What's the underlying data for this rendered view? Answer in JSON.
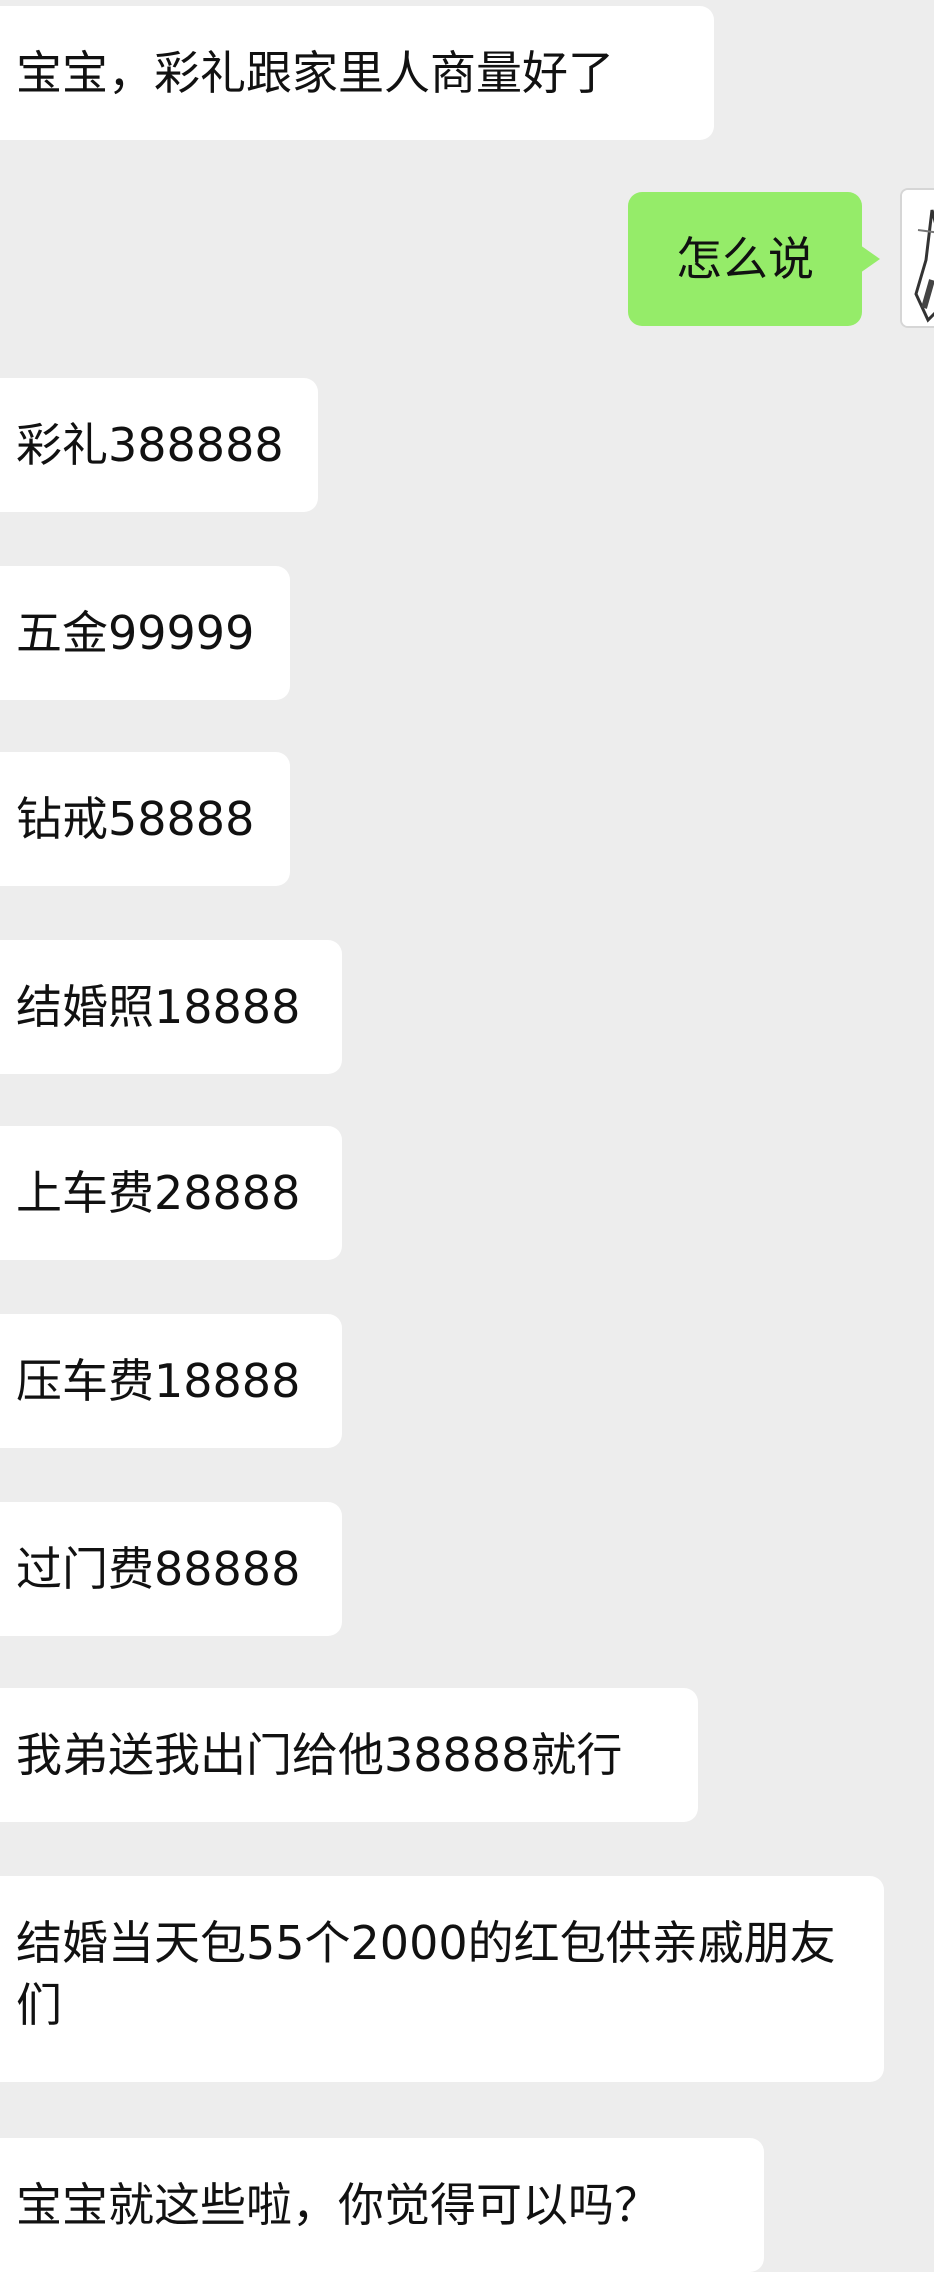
{
  "chat": {
    "messages": [
      {
        "side": "left",
        "text": "宝宝，彩礼跟家里人商量好了"
      },
      {
        "side": "right",
        "text": "怎么说"
      },
      {
        "side": "left",
        "text": "彩礼388888"
      },
      {
        "side": "left",
        "text": "五金99999"
      },
      {
        "side": "left",
        "text": "钻戒58888"
      },
      {
        "side": "left",
        "text": "结婚照18888"
      },
      {
        "side": "left",
        "text": "上车费28888"
      },
      {
        "side": "left",
        "text": "压车费18888"
      },
      {
        "side": "left",
        "text": "过门费88888"
      },
      {
        "side": "left",
        "text": "我弟送我出门给他38888就行"
      },
      {
        "side": "left",
        "text": "结婚当天包55个2000的红包供亲戚朋友们"
      },
      {
        "side": "left",
        "text": "宝宝就这些啦，你觉得可以吗？"
      }
    ]
  },
  "colors": {
    "background": "#ededed",
    "incoming_bubble": "#ffffff",
    "outgoing_bubble": "#95ec69",
    "text": "#111111"
  }
}
